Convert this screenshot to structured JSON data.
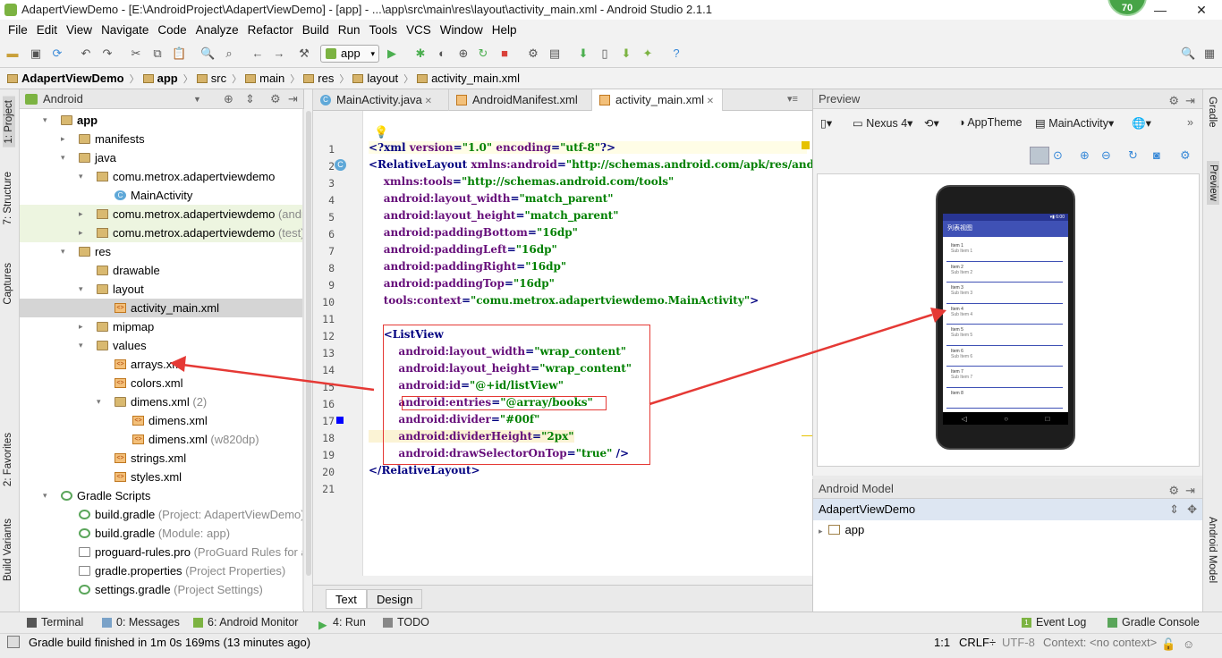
{
  "window": {
    "title": "AdapertViewDemo - [E:\\AndroidProject\\AdapertViewDemo] - [app] - ...\\app\\src\\main\\res\\layout\\activity_main.xml - Android Studio 2.1.1",
    "badge": "70",
    "min": "—",
    "max": "❐",
    "close": "✕"
  },
  "menu": [
    "File",
    "Edit",
    "View",
    "Navigate",
    "Code",
    "Analyze",
    "Refactor",
    "Build",
    "Run",
    "Tools",
    "VCS",
    "Window",
    "Help"
  ],
  "toolbar": {
    "run_config": "app"
  },
  "breadcrumb": [
    "AdapertViewDemo",
    "app",
    "src",
    "main",
    "res",
    "layout",
    "activity_main.xml"
  ],
  "left_strip": {
    "project": "1: Project",
    "structure": "7: Structure",
    "captures": "Captures",
    "favorites": "2: Favorites",
    "build_variants": "Build Variants"
  },
  "right_strip": {
    "gradle": "Gradle",
    "preview": "Preview",
    "android_model": "Android Model"
  },
  "project_panel": {
    "view_mode": "Android",
    "tree": [
      {
        "label": "app",
        "extra": "",
        "depth": 0,
        "arrow": "▾",
        "icon": "folder-icon",
        "bold": true
      },
      {
        "label": "manifests",
        "extra": "",
        "depth": 1,
        "arrow": "▸",
        "icon": "folder-icon"
      },
      {
        "label": "java",
        "extra": "",
        "depth": 1,
        "arrow": "▾",
        "icon": "folder-icon"
      },
      {
        "label": "comu.metrox.adapertviewdemo",
        "extra": "",
        "depth": 2,
        "arrow": "▾",
        "icon": "package-icon"
      },
      {
        "label": "MainActivity",
        "extra": "",
        "depth": 3,
        "arrow": "",
        "icon": "class-icon"
      },
      {
        "label": "comu.metrox.adapertviewdemo",
        "extra": " (androidTest)",
        "depth": 2,
        "arrow": "▸",
        "icon": "package-icon",
        "green": true
      },
      {
        "label": "comu.metrox.adapertviewdemo",
        "extra": " (test)",
        "depth": 2,
        "arrow": "▸",
        "icon": "package-icon",
        "green": true
      },
      {
        "label": "res",
        "extra": "",
        "depth": 1,
        "arrow": "▾",
        "icon": "folder-icon"
      },
      {
        "label": "drawable",
        "extra": "",
        "depth": 2,
        "arrow": "",
        "icon": "folder-icon"
      },
      {
        "label": "layout",
        "extra": "",
        "depth": 2,
        "arrow": "▾",
        "icon": "folder-icon"
      },
      {
        "label": "activity_main.xml",
        "extra": "",
        "depth": 3,
        "arrow": "",
        "icon": "xml-icon",
        "selected": true
      },
      {
        "label": "mipmap",
        "extra": "",
        "depth": 2,
        "arrow": "▸",
        "icon": "folder-icon"
      },
      {
        "label": "values",
        "extra": "",
        "depth": 2,
        "arrow": "▾",
        "icon": "folder-icon"
      },
      {
        "label": "arrays.xml",
        "extra": "",
        "depth": 3,
        "arrow": "",
        "icon": "xml-icon"
      },
      {
        "label": "colors.xml",
        "extra": "",
        "depth": 3,
        "arrow": "",
        "icon": "xml-icon"
      },
      {
        "label": "dimens.xml",
        "extra": " (2)",
        "depth": 3,
        "arrow": "▾",
        "icon": "folder-icon"
      },
      {
        "label": "dimens.xml",
        "extra": "",
        "depth": 4,
        "arrow": "",
        "icon": "xml-icon"
      },
      {
        "label": "dimens.xml",
        "extra": " (w820dp)",
        "depth": 4,
        "arrow": "",
        "icon": "xml-icon"
      },
      {
        "label": "strings.xml",
        "extra": "",
        "depth": 3,
        "arrow": "",
        "icon": "xml-icon"
      },
      {
        "label": "styles.xml",
        "extra": "",
        "depth": 3,
        "arrow": "",
        "icon": "xml-icon"
      },
      {
        "label": "Gradle Scripts",
        "extra": "",
        "depth": 0,
        "arrow": "▾",
        "icon": "gradle-icon"
      },
      {
        "label": "build.gradle",
        "extra": " (Project: AdapertViewDemo)",
        "depth": 1,
        "arrow": "",
        "icon": "gradle-icon"
      },
      {
        "label": "build.gradle",
        "extra": " (Module: app)",
        "depth": 1,
        "arrow": "",
        "icon": "gradle-icon"
      },
      {
        "label": "proguard-rules.pro",
        "extra": " (ProGuard Rules for app)",
        "depth": 1,
        "arrow": "",
        "icon": "file-icon"
      },
      {
        "label": "gradle.properties",
        "extra": " (Project Properties)",
        "depth": 1,
        "arrow": "",
        "icon": "file-icon"
      },
      {
        "label": "settings.gradle",
        "extra": " (Project Settings)",
        "depth": 1,
        "arrow": "",
        "icon": "gradle-icon"
      }
    ]
  },
  "editor_tabs": [
    {
      "label": "MainActivity.java",
      "icon": "class-icon"
    },
    {
      "label": "AndroidManifest.xml",
      "icon": "xml-icon"
    },
    {
      "label": "activity_main.xml",
      "icon": "xml-icon",
      "active": true
    }
  ],
  "editor": {
    "lines": [
      {
        "n": "1",
        "html": "<span class='tag'>&lt;?xml </span><span class='attr'>version</span>=<span class='val'>\"1.0\"</span> <span class='attr'>encoding</span>=<span class='val'>\"utf-8\"</span><span class='tag'>?&gt;</span>"
      },
      {
        "n": "2",
        "html": "<span class='tag'>&lt;RelativeLayout </span><span class='attr'>xmlns:android</span>=<span class='val'>\"http://schemas.android.com/apk/res/android\"</span>"
      },
      {
        "n": "3",
        "html": "    <span class='attr'>xmlns:tools</span>=<span class='val'>\"http://schemas.android.com/tools\"</span>"
      },
      {
        "n": "4",
        "html": "    <span class='attr'>android:layout_width</span>=<span class='val'>\"match_parent\"</span>"
      },
      {
        "n": "5",
        "html": "    <span class='attr'>android:layout_height</span>=<span class='val'>\"match_parent\"</span>"
      },
      {
        "n": "6",
        "html": "    <span class='attr'>android:paddingBottom</span>=<span class='val'>\"16dp\"</span>"
      },
      {
        "n": "7",
        "html": "    <span class='attr'>android:paddingLeft</span>=<span class='val'>\"16dp\"</span>"
      },
      {
        "n": "8",
        "html": "    <span class='attr'>android:paddingRight</span>=<span class='val'>\"16dp\"</span>"
      },
      {
        "n": "9",
        "html": "    <span class='attr'>android:paddingTop</span>=<span class='val'>\"16dp\"</span>"
      },
      {
        "n": "10",
        "html": "    <span class='attr'>tools:context</span>=<span class='val'>\"comu.metrox.adapertviewdemo.MainActivity\"</span><span class='tag'>&gt;</span>"
      },
      {
        "n": "11",
        "html": ""
      },
      {
        "n": "12",
        "html": "    <span class='tag'>&lt;ListView</span>"
      },
      {
        "n": "13",
        "html": "        <span class='attr'>android:layout_width</span>=<span class='val'>\"wrap_content\"</span>"
      },
      {
        "n": "14",
        "html": "        <span class='attr'>android:layout_height</span>=<span class='val'>\"wrap_content\"</span>"
      },
      {
        "n": "15",
        "html": "        <span class='attr'>android:id</span>=<span class='val'>\"@+id/listView\"</span>"
      },
      {
        "n": "16",
        "html": "        <span class='attr'>android:entries</span>=<span class='val'>\"@array/books\"</span>"
      },
      {
        "n": "17",
        "html": "        <span class='attr'>android:divider</span>=<span class='val'>\"#00f\"</span>"
      },
      {
        "n": "18",
        "html": "        <span class='attr'>android:dividerHeight</span>=<span class='val'>\"2px\"</span>"
      },
      {
        "n": "19",
        "html": "        <span class='attr'>android:drawSelectorOnTop</span>=<span class='val'>\"true\"</span> <span class='tag'>/&gt;</span>"
      },
      {
        "n": "20",
        "html": "<span class='tag'>&lt;/RelativeLayout&gt;</span>"
      },
      {
        "n": "21",
        "html": ""
      }
    ],
    "bottom_tabs": [
      "Text",
      "Design"
    ]
  },
  "preview": {
    "title": "Preview",
    "device": "Nexus 4",
    "theme": "AppTheme",
    "activity": "MainActivity",
    "phone_app_title": "列表视图",
    "phone_time": "6:00",
    "list_items": [
      {
        "title": "Item 1",
        "sub": "Sub Item 1"
      },
      {
        "title": "Item 2",
        "sub": "Sub Item 2"
      },
      {
        "title": "Item 3",
        "sub": "Sub Item 3"
      },
      {
        "title": "Item 4",
        "sub": "Sub Item 4"
      },
      {
        "title": "Item 5",
        "sub": "Sub Item 5"
      },
      {
        "title": "Item 6",
        "sub": "Sub Item 6"
      },
      {
        "title": "Item 7",
        "sub": "Sub Item 7"
      },
      {
        "title": "Item 8",
        "sub": ""
      }
    ]
  },
  "android_model": {
    "title": "Android Model",
    "project": "AdapertViewDemo",
    "child": "app"
  },
  "bottom_tools": {
    "terminal": "Terminal",
    "messages": "0: Messages",
    "monitor": "6: Android Monitor",
    "run": "4: Run",
    "todo": "TODO",
    "event_log": "Event Log",
    "event_count": "1",
    "gradle_console": "Gradle Console"
  },
  "status": {
    "message": "Gradle build finished in 1m 0s 169ms (13 minutes ago)",
    "position": "1:1",
    "line_sep": "CRLF÷",
    "encoding": "UTF-8",
    "context": "Context: <no context>"
  },
  "colors": {
    "selection": "#d5d5d5",
    "test_pkg_bg": "#edf5e0",
    "annotation_red": "#e53935",
    "phone_bar": "#3f51b5"
  }
}
